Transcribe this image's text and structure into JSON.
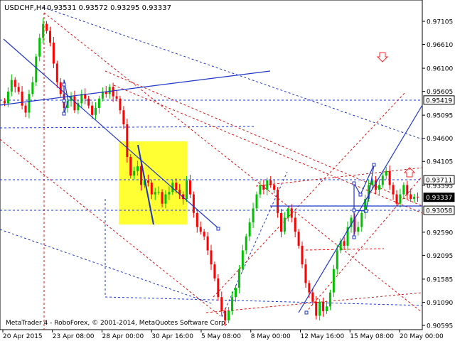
{
  "header": {
    "symbol": "USDCHF,H4",
    "ohlc": "0.93531 0.93572 0.93295 0.93337"
  },
  "footer": {
    "copyright": "MetaTrader 4 - RoboForex, © 2001-2014, MetaQuotes Software Corp."
  },
  "chart_data": {
    "type": "candlestick",
    "y_ticks": [
      "0.97105",
      "0.96610",
      "0.96100",
      "0.95605",
      "0.95095",
      "0.94600",
      "0.94105",
      "0.93595",
      "0.92590",
      "0.92095",
      "0.91585",
      "0.91090",
      "0.90595"
    ],
    "ylim": [
      0.904,
      0.9745
    ],
    "x_ticks": [
      "20 Apr 2015",
      "23 Apr 08:00",
      "28 Apr 00:00",
      "30 Apr 16:00",
      "5 May 08:00",
      "8 May 00:00",
      "12 May 16:00",
      "15 May 08:00",
      "20 May 00:00"
    ],
    "price_labels": [
      {
        "text": "0.95419",
        "value": 0.95419,
        "style": "outline"
      },
      {
        "text": "0.93711",
        "value": 0.93711,
        "style": "outline"
      },
      {
        "text": "0.93337",
        "value": 0.93337,
        "style": "filled"
      },
      {
        "text": "0.93058",
        "value": 0.93058,
        "style": "outline"
      }
    ],
    "close_series": [
      0.9535,
      0.956,
      0.9585,
      0.957,
      0.956,
      0.953,
      0.9515,
      0.9555,
      0.958,
      0.9635,
      0.9675,
      0.9705,
      0.969,
      0.9665,
      0.962,
      0.958,
      0.9555,
      0.9525,
      0.954,
      0.955,
      0.952,
      0.9535,
      0.9555,
      0.9545,
      0.953,
      0.951,
      0.9525,
      0.9545,
      0.956,
      0.9555,
      0.957,
      0.955,
      0.9545,
      0.952,
      0.949,
      0.942,
      0.938,
      0.939,
      0.94,
      0.936,
      0.937,
      0.9365,
      0.934,
      0.9345,
      0.9345,
      0.932,
      0.934,
      0.9345,
      0.9365,
      0.935,
      0.934,
      0.933,
      0.937,
      0.934,
      0.93,
      0.927,
      0.926,
      0.925,
      0.922,
      0.919,
      0.916,
      0.912,
      0.909,
      0.907,
      0.909,
      0.912,
      0.914,
      0.918,
      0.922,
      0.925,
      0.928,
      0.931,
      0.934,
      0.936,
      0.935,
      0.937,
      0.936,
      0.935,
      0.93,
      0.926,
      0.929,
      0.931,
      0.929,
      0.926,
      0.923,
      0.919,
      0.915,
      0.913,
      0.911,
      0.908,
      0.911,
      0.909,
      0.91,
      0.913,
      0.918,
      0.922,
      0.924,
      0.923,
      0.927,
      0.929,
      0.926,
      0.927,
      0.93,
      0.933,
      0.936,
      0.937,
      0.935,
      0.936,
      0.938,
      0.939,
      0.936,
      0.934,
      0.932,
      0.934,
      0.936,
      0.934,
      0.933,
      0.9335,
      0.9334
    ],
    "arrows": [
      {
        "direction": "down",
        "color": "#ff2a2a"
      },
      {
        "direction": "up",
        "color": "#ff2a2a"
      }
    ],
    "colors": {
      "bull": "#00c000",
      "bear": "#ff0000",
      "trendline_blue": "#1f36c8",
      "trendline_red": "#e01010",
      "highlight": "#ffff33"
    },
    "grid": false
  }
}
